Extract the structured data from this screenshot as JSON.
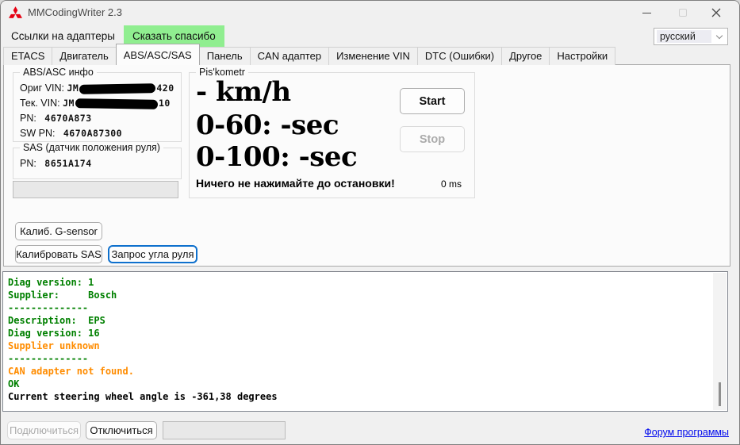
{
  "window": {
    "title": "MMCodingWriter 2.3"
  },
  "menu": {
    "adapters_label": "Ссылки на адаптеры",
    "thanks_label": "Сказать спасибо",
    "language_selected": "русский"
  },
  "tabs": {
    "items": [
      "ETACS",
      "Двигатель",
      "ABS/ASC/SAS",
      "Панель",
      "CAN адаптер",
      "Изменение VIN",
      "DTC (Ошибки)",
      "Другое",
      "Настройки"
    ],
    "active_index": 2
  },
  "abs_info": {
    "title": "ABS/ASC инфо",
    "orig_vin_label": "Ориг VIN:",
    "orig_vin_prefix": "JM",
    "orig_vin_suffix": "420",
    "cur_vin_label": "Тек. VIN:",
    "cur_vin_prefix": "JM",
    "cur_vin_suffix": "10",
    "pn_label": "PN:",
    "pn_value": "4670A873",
    "sw_pn_label": "SW PN:",
    "sw_pn_value": "4670A87300"
  },
  "sas": {
    "title": "SAS (датчик положения руля)",
    "pn_label": "PN:",
    "pn_value": "8651A174"
  },
  "piskometr": {
    "title": "Pis'kometr",
    "speed": "- km/h",
    "accel_60": "0-60: -sec",
    "accel_100": "0-100: -sec",
    "warning": "Ничего не нажимайте до остановки!",
    "elapsed_ms": "0 ms",
    "start_label": "Start",
    "stop_label": "Stop"
  },
  "actions": {
    "g_sensor_label": "Калиб. G-sensor",
    "sas_calibrate_label": "Калибровать SAS",
    "angle_request_label": "Запрос угла руля"
  },
  "log": {
    "lines": [
      {
        "text": "Diag version: 1",
        "color": "green"
      },
      {
        "text": "Supplier:     Bosch",
        "color": "green"
      },
      {
        "text": "--------------",
        "color": "green"
      },
      {
        "text": "Description:  EPS",
        "color": "green"
      },
      {
        "text": "Diag version: 16",
        "color": "green"
      },
      {
        "text": "Supplier unknown",
        "color": "orange"
      },
      {
        "text": "--------------",
        "color": "green"
      },
      {
        "text": "CAN adapter not found.",
        "color": "orange"
      },
      {
        "text": "OK",
        "color": "green"
      },
      {
        "text": "Current steering wheel angle is -361,38 degrees",
        "color": "black"
      }
    ]
  },
  "footer": {
    "connect_label": "Подключиться",
    "disconnect_label": "Отключиться",
    "forum_link_label": "Форум программы"
  },
  "colors": {
    "green": "#008000",
    "orange": "#FF8C00",
    "black": "#000000",
    "thanks_green": "#90EE90",
    "focus_blue": "#0E70CD",
    "link_blue": "#0009EE",
    "mitsubishi_red": "#E60012"
  }
}
